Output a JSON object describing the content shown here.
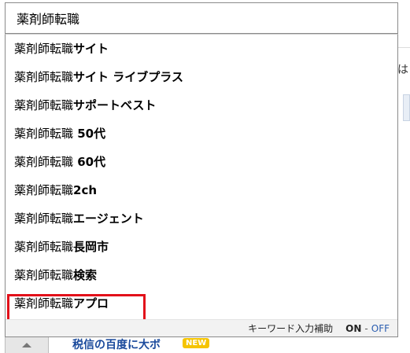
{
  "search": {
    "value": "薬剤師転職"
  },
  "suggestions": [
    {
      "typed": "薬剤師転職",
      "rest": "サイト"
    },
    {
      "typed": "薬剤師転職",
      "rest": "サイト ライブプラス"
    },
    {
      "typed": "薬剤師転職",
      "rest": "サポートベスト"
    },
    {
      "typed": "薬剤師転職",
      "rest": " 50代"
    },
    {
      "typed": "薬剤師転職",
      "rest": " 60代"
    },
    {
      "typed": "薬剤師転職",
      "rest": "2ch"
    },
    {
      "typed": "薬剤師転職",
      "rest": "エージェント"
    },
    {
      "typed": "薬剤師転職",
      "rest": "長岡市"
    },
    {
      "typed": "薬剤師転職",
      "rest": "検索"
    },
    {
      "typed": "薬剤師転職",
      "rest": "アプロ"
    }
  ],
  "footer": {
    "label": "キーワード入力補助",
    "on": "ON",
    "sep": "-",
    "off": "OFF"
  },
  "background": {
    "right_fragment": "は",
    "bottom_text": "税信の百度に大ボ",
    "new_badge": "NEW"
  },
  "colors": {
    "highlight": "#e2101a",
    "off_link": "#2a5db0"
  }
}
